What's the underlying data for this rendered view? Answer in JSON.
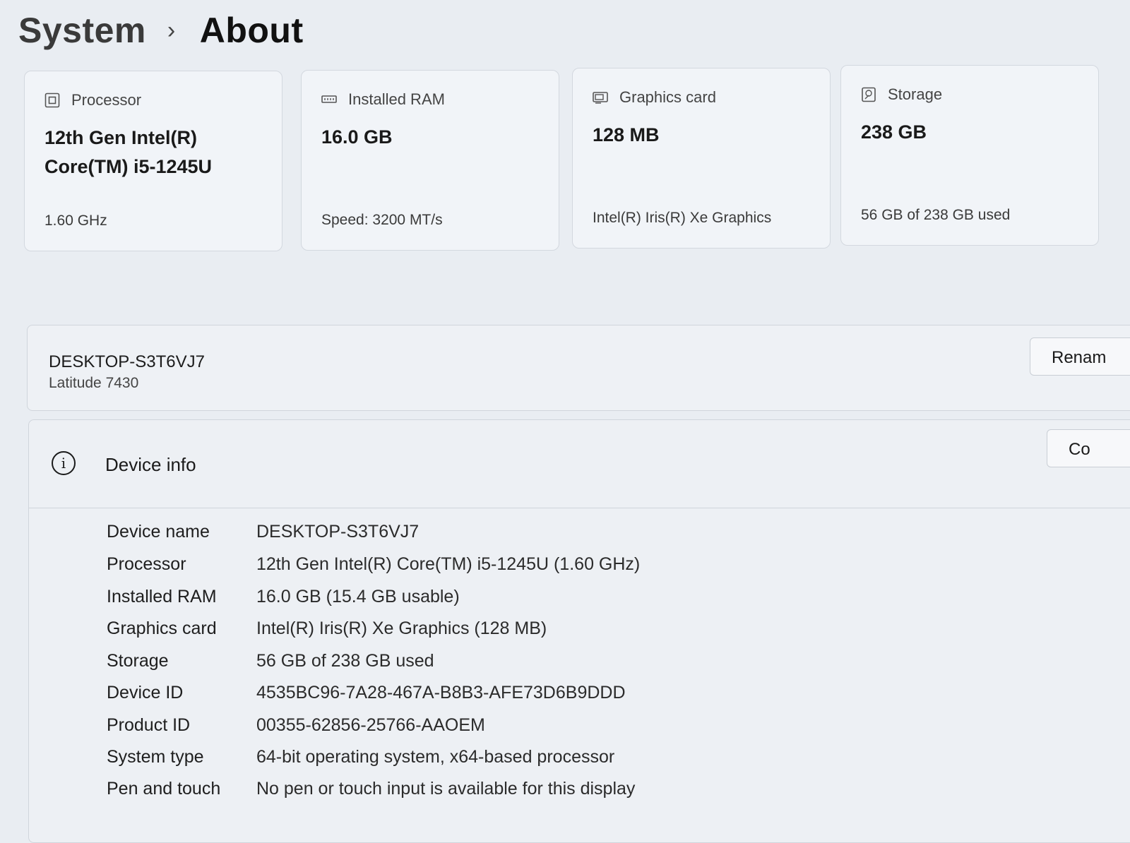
{
  "breadcrumb": {
    "parent": "System",
    "separator": "›",
    "current": "About"
  },
  "cards": [
    {
      "icon": "processor-icon",
      "title": "Processor",
      "value": "12th Gen Intel(R) Core(TM) i5-1245U",
      "sub": "1.60 GHz"
    },
    {
      "icon": "ram-icon",
      "title": "Installed RAM",
      "value": "16.0 GB",
      "sub": "Speed: 3200 MT/s"
    },
    {
      "icon": "graphics-card-icon",
      "title": "Graphics card",
      "value": "128 MB",
      "sub": "Intel(R) Iris(R) Xe Graphics"
    },
    {
      "icon": "storage-icon",
      "title": "Storage",
      "value": "238 GB",
      "sub": "56 GB of 238 GB used"
    }
  ],
  "device": {
    "name": "DESKTOP-S3T6VJ7",
    "model": "Latitude 7430",
    "rename_label": "Renam",
    "copy_label": "Co"
  },
  "device_info": {
    "title": "Device info",
    "info_icon": "info-icon",
    "rows": [
      {
        "label": "Device name",
        "value": "DESKTOP-S3T6VJ7"
      },
      {
        "label": "Processor",
        "value": "12th Gen Intel(R) Core(TM) i5-1245U (1.60 GHz)"
      },
      {
        "label": "Installed RAM",
        "value": "16.0 GB (15.4 GB usable)"
      },
      {
        "label": "Graphics card",
        "value": "Intel(R) Iris(R) Xe Graphics (128 MB)"
      },
      {
        "label": "Storage",
        "value": "56 GB of 238 GB used"
      },
      {
        "label": "Device ID",
        "value": "4535BC96-7A28-467A-B8B3-AFE73D6B9DDD"
      },
      {
        "label": "Product ID",
        "value": "00355-62856-25766-AAOEM"
      },
      {
        "label": "System type",
        "value": "64-bit operating system, x64-based processor"
      },
      {
        "label": "Pen and touch",
        "value": "No pen or touch input is available for this display"
      }
    ]
  }
}
